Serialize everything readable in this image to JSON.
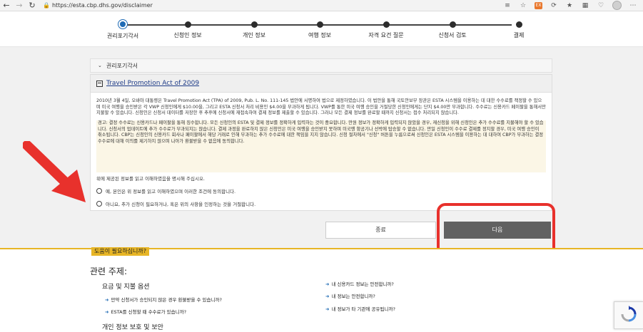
{
  "browser": {
    "url": "https://esta.cbp.dhs.gov/disclaimer"
  },
  "stepper": {
    "steps": [
      {
        "label": "권리포기각서"
      },
      {
        "label": "신청인 정보"
      },
      {
        "label": "개인 정보"
      },
      {
        "label": "여행 정보"
      },
      {
        "label": "자격 요건 질문"
      },
      {
        "label": "신청서 검토"
      },
      {
        "label": "결제"
      }
    ]
  },
  "accordion": {
    "label": "권리포기각서"
  },
  "card": {
    "title": "Travel Promotion Act of 2009",
    "para1": "2010년 3월 4일, 오바마 대통령은 Travel Promotion Act (TPA) of 2009, Pub. L. No. 111-145 법안에 서명하여 법으로 제정하였습니다. 이 법안을 통해 국토안보부 장관은 ESTA 시스템을 이용하는 데 대한 수수료를 책정할 수 있으며 미국 여행을 승인받은 각 VWP 신청인에게 $10.00을, 그리고 ESTA 신청서 처리 비용인 $4.00을 부과하게 됩니다. VWP를 통한 미국 여행 승인을 거절당한 신청인에게는 단지 $4.00만 부과합니다. 수수료는 신용카드 페이팔을 통해서만 지불할 수 있습니다. 신청인은 신청서 데이터를 저장한 후 추후에 신청서에 재접속하여 결제 정보를 제출할 수 있습니다. 그러나 모든 결제 정보를 완료할 때까지 신청서는 접수 처리되지 않습니다.",
    "para2": "경고: 결정 수수료는 신용카드나 페이팔을 통해 징수합니다. 모든 신청인의 ESTA 및 결제 정보를 정확하게 입력하는 것이 중요합니다. 만원 정보가 정확하게 입력되지 않았을 경우, 재신청을 위해 신청인은 추가 수수료를 지불해야 할 수 있습니다. 신청서의 업데이트에 추가 수수료가 부과되지는 않습니다. 결제 과정을 완료하지 않은 신청인은 미국 여행을 승인받지 못하며 미국행 항공기나 선박에 탑승할 수 없습니다. 만일 신청인이 수수료 결제를 정지할 경우, 미국 여행 승인이 취소됩니다. CBP는 신청인의 신용카드 회사나 페이팔에서 해당 거래로 인해 부과하는 추가 수수료에 대한 책임을 지지 않습니다. 신청 절차에서 \"신청\" 버튼을 누름으로써 신청인은 ESTA 시스템을 이용하는 데 대하여 CBP가 부과하는 결정 수수료에 대해 이의를 제기하지 않으며 나아가 환불받을 수 없음에 동의합니다.",
    "question": "위에 제공된 정보를 읽고 이해하였음을 명시해 주십시오.",
    "option_yes": "예, 본인은 위 정보를 읽고 이해하였으며 이러한 조건에 동의합니다.",
    "option_no": "아니요, 추가 신청이 필요하거나, 혹은 위의 사항을 인정하는 것을 거절합니다."
  },
  "buttons": {
    "cancel": "종료",
    "next": "다음"
  },
  "footer": {
    "help": "도움이 필요하십니까?",
    "related": "관련 주제:",
    "section1": "요금 및 지불 옵션",
    "section2": "개인 정보 보호 및 보안",
    "links_left": [
      "만약 신청서가 승인되지 않은 경우 환불받을 수 있습니까?",
      "ESTA를 신청할 때 수수료가 있습니까?"
    ],
    "links_right": [
      "내 신용카드 정보는 안전합니까?",
      "내 정보는 안전합니까?",
      "내 정보가 타 기관에 공유됩니까?"
    ]
  },
  "colors": {
    "accent": "#1f6bb5",
    "gold": "#e7b526",
    "annotation_red": "#e8312c",
    "next_button": "#616161"
  }
}
